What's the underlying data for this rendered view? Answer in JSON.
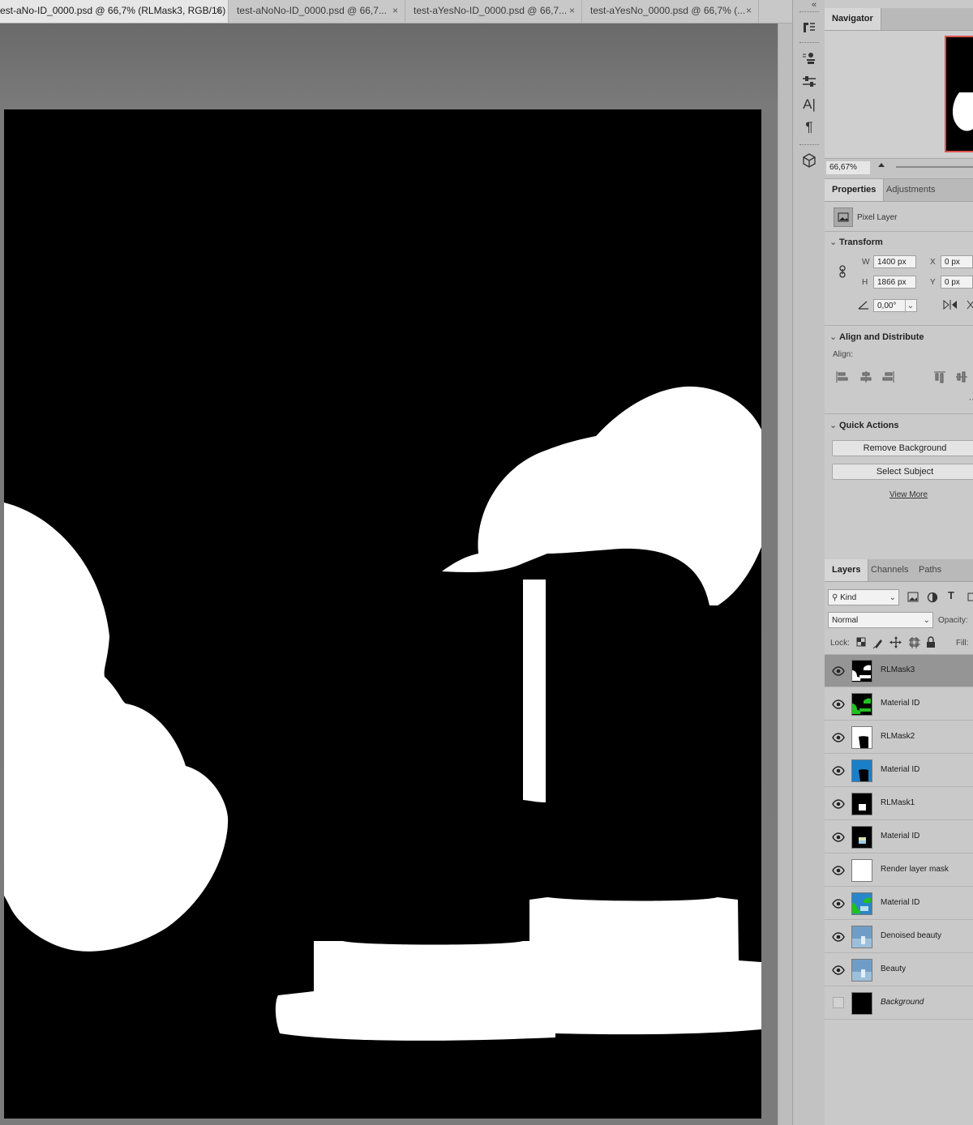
{
  "document_tabs": [
    {
      "label": "est-aNo-ID_0000.psd @ 66,7% (RLMask3, RGB/16)",
      "active": true,
      "close": "×"
    },
    {
      "label": "test-aNoNo-ID_0000.psd @ 66,7...",
      "active": false,
      "close": "×"
    },
    {
      "label": "test-aYesNo-ID_0000.psd @ 66,7...",
      "active": false,
      "close": "×"
    },
    {
      "label": "test-aYesNo_0000.psd @ 66,7% (...",
      "active": false,
      "close": "×"
    }
  ],
  "toolstrip": {
    "icons": [
      "history-icon",
      "clone-source-icon",
      "adjustments-sliders-icon",
      "character-icon",
      "paragraph-icon",
      "3d-cube-icon"
    ],
    "glyph_character": "A|",
    "glyph_paragraph": "¶",
    "collapse": "«"
  },
  "navigator": {
    "tab": "Navigator",
    "zoom": "66,67%"
  },
  "properties": {
    "tabs": [
      "Properties",
      "Adjustments"
    ],
    "layer_type": "Pixel Layer",
    "transform": {
      "title": "Transform",
      "w_label": "W",
      "w": "1400 px",
      "h_label": "H",
      "h": "1866 px",
      "x_label": "X",
      "x": "0 px",
      "y_label": "Y",
      "y": "0 px",
      "angle": "0,00°"
    },
    "align": {
      "title": "Align and Distribute",
      "label": "Align:"
    },
    "quick_actions": {
      "title": "Quick Actions",
      "remove_background": "Remove Background",
      "select_subject": "Select Subject",
      "view_more": "View More"
    }
  },
  "layers_panel": {
    "tabs": [
      "Layers",
      "Channels",
      "Paths"
    ],
    "filter_kind": "Kind",
    "blend_mode": "Normal",
    "opacity_label": "Opacity:",
    "lock_label": "Lock:",
    "fill_label": "Fill:",
    "filter_type_glyph": "T",
    "layers": [
      {
        "name": "RLMask3",
        "visible": true,
        "selected": true,
        "thumb": "mask3"
      },
      {
        "name": "Material ID",
        "visible": true,
        "selected": false,
        "thumb": "green"
      },
      {
        "name": "RLMask2",
        "visible": true,
        "selected": false,
        "thumb": "mask2"
      },
      {
        "name": "Material ID",
        "visible": true,
        "selected": false,
        "thumb": "blue"
      },
      {
        "name": "RLMask1",
        "visible": true,
        "selected": false,
        "thumb": "mask1"
      },
      {
        "name": "Material ID",
        "visible": true,
        "selected": false,
        "thumb": "pastel"
      },
      {
        "name": "Render layer mask",
        "visible": true,
        "selected": false,
        "thumb": "white"
      },
      {
        "name": "Material ID",
        "visible": true,
        "selected": false,
        "thumb": "multi"
      },
      {
        "name": "Denoised beauty",
        "visible": true,
        "selected": false,
        "thumb": "beauty"
      },
      {
        "name": "Beauty",
        "visible": true,
        "selected": false,
        "thumb": "beauty"
      },
      {
        "name": "Background",
        "visible": false,
        "selected": false,
        "thumb": "black",
        "italic": true
      }
    ]
  }
}
